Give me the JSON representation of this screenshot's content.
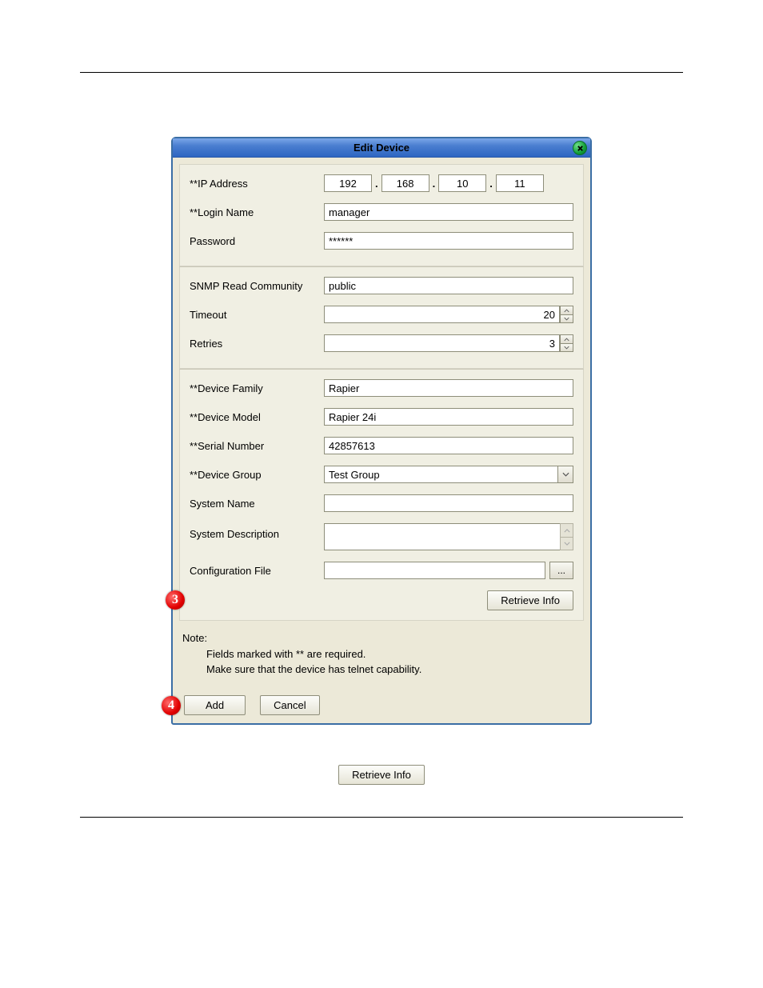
{
  "dialog": {
    "title": "Edit Device",
    "close_label": "Close"
  },
  "labels": {
    "ip": "**IP Address",
    "login": "**Login Name",
    "password": "Password",
    "snmp": "SNMP Read Community",
    "timeout": "Timeout",
    "retries": "Retries",
    "family": "**Device Family",
    "model": "**Device Model",
    "serial": "**Serial Number",
    "group": "**Device Group",
    "sysname": "System Name",
    "sysdesc": "System Description",
    "config": "Configuration File"
  },
  "fields": {
    "ip": {
      "o1": "192",
      "o2": "168",
      "o3": "10",
      "o4": "11"
    },
    "login": "manager",
    "password": "******",
    "snmp": "public",
    "timeout": "20",
    "retries": "3",
    "family": "Rapier",
    "model": "Rapier 24i",
    "serial": "42857613",
    "group": "Test Group",
    "sysname": "",
    "sysdesc": "",
    "config": "",
    "browse": "..."
  },
  "buttons": {
    "retrieve": "Retrieve Info",
    "add": "Add",
    "cancel": "Cancel"
  },
  "note": {
    "heading": "Note:",
    "line1": "Fields marked with ** are required.",
    "line2": "Make sure that the device has telnet capability."
  },
  "callouts": {
    "c3": "3",
    "c4": "4"
  },
  "below": {
    "retrieve": "Retrieve Info"
  }
}
